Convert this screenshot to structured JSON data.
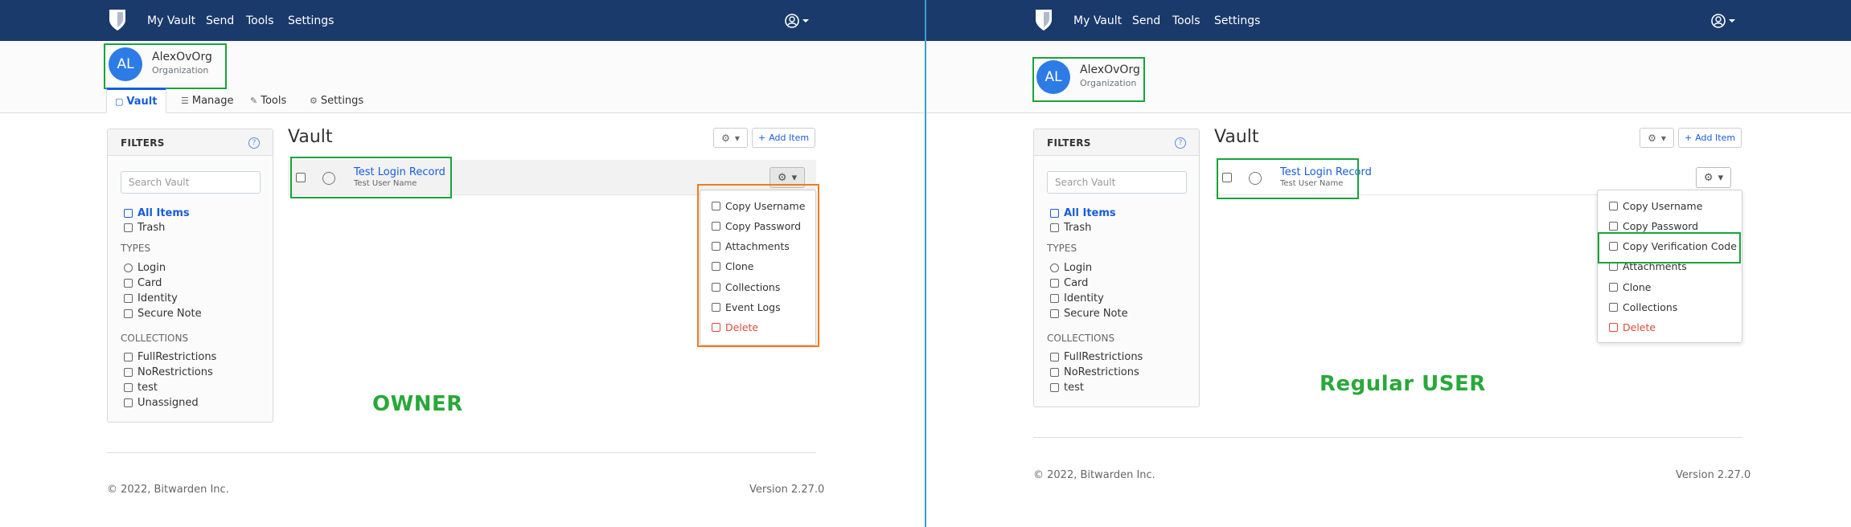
{
  "left": {
    "nav": {
      "links": [
        "My Vault",
        "Send",
        "Tools",
        "Settings"
      ]
    },
    "org": {
      "initials": "AL",
      "name": "AlexOvOrg",
      "type": "Organization"
    },
    "tabs": [
      {
        "label": "Vault",
        "icon": "lock-icon"
      },
      {
        "label": "Manage",
        "icon": "sliders-icon"
      },
      {
        "label": "Tools",
        "icon": "wrench-icon"
      },
      {
        "label": "Settings",
        "icon": "gears-icon"
      }
    ],
    "filters": {
      "title": "FILTERS",
      "search_placeholder": "Search Vault",
      "all_items": "All Items",
      "trash": "Trash",
      "types_heading": "TYPES",
      "types": [
        "Login",
        "Card",
        "Identity",
        "Secure Note"
      ],
      "collections_heading": "COLLECTIONS",
      "collections": [
        "FullRestrictions",
        "NoRestrictions",
        "test",
        "Unassigned"
      ]
    },
    "vault": {
      "title": "Vault",
      "add_label": "Add Item"
    },
    "item": {
      "title": "Test Login Record",
      "subtitle": "Test User Name"
    },
    "menu": [
      "Copy Username",
      "Copy Password",
      "Attachments",
      "Clone",
      "Collections",
      "Event Logs",
      "Delete"
    ],
    "label": "OWNER",
    "footer": {
      "copyright": "© 2022, Bitwarden Inc.",
      "version": "Version 2.27.0"
    }
  },
  "right": {
    "nav": {
      "links": [
        "My Vault",
        "Send",
        "Tools",
        "Settings"
      ]
    },
    "org": {
      "initials": "AL",
      "name": "AlexOvOrg",
      "type": "Organization"
    },
    "filters": {
      "title": "FILTERS",
      "search_placeholder": "Search Vault",
      "all_items": "All Items",
      "trash": "Trash",
      "types_heading": "TYPES",
      "types": [
        "Login",
        "Card",
        "Identity",
        "Secure Note"
      ],
      "collections_heading": "COLLECTIONS",
      "collections": [
        "FullRestrictions",
        "NoRestrictions",
        "test"
      ]
    },
    "vault": {
      "title": "Vault",
      "add_label": "Add Item"
    },
    "item": {
      "title": "Test Login Record",
      "subtitle": "Test User Name"
    },
    "menu": [
      "Copy Username",
      "Copy Password",
      "Copy Verification Code",
      "Attachments",
      "Clone",
      "Collections",
      "Delete"
    ],
    "label": "Regular USER",
    "footer": {
      "copyright": "© 2022, Bitwarden Inc.",
      "version": "Version 2.27.0"
    }
  },
  "colors": {
    "navbar": "#1a3a6b",
    "accent": "#175ddc",
    "highlight_green": "#1aa339",
    "highlight_orange": "#f07c1f",
    "danger": "#dd4b39"
  }
}
